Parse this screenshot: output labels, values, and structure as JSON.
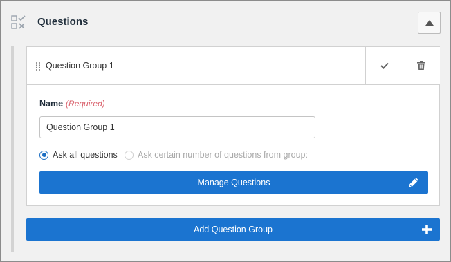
{
  "panel": {
    "title": "Questions",
    "icons": {
      "section": "checklist-icon",
      "collapse": "chevron-up-icon"
    }
  },
  "group": {
    "title": "Question Group 1",
    "icons": {
      "drag": "drag-handle-icon",
      "confirm": "check-icon",
      "delete": "trash-icon"
    },
    "name_label": "Name",
    "required_label": "(Required)",
    "name_value": "Question Group 1",
    "radio_options": [
      {
        "label": "Ask all questions",
        "selected": true,
        "enabled": true
      },
      {
        "label": "Ask certain number of questions from group:",
        "selected": false,
        "enabled": false
      }
    ],
    "manage_label": "Manage Questions",
    "manage_icon": "pencil-icon"
  },
  "add_group": {
    "label": "Add Question Group",
    "icon": "plus-icon"
  },
  "colors": {
    "primary": "#1b74d0",
    "required": "#d9606b",
    "panel_bg": "#f1f1f1"
  }
}
